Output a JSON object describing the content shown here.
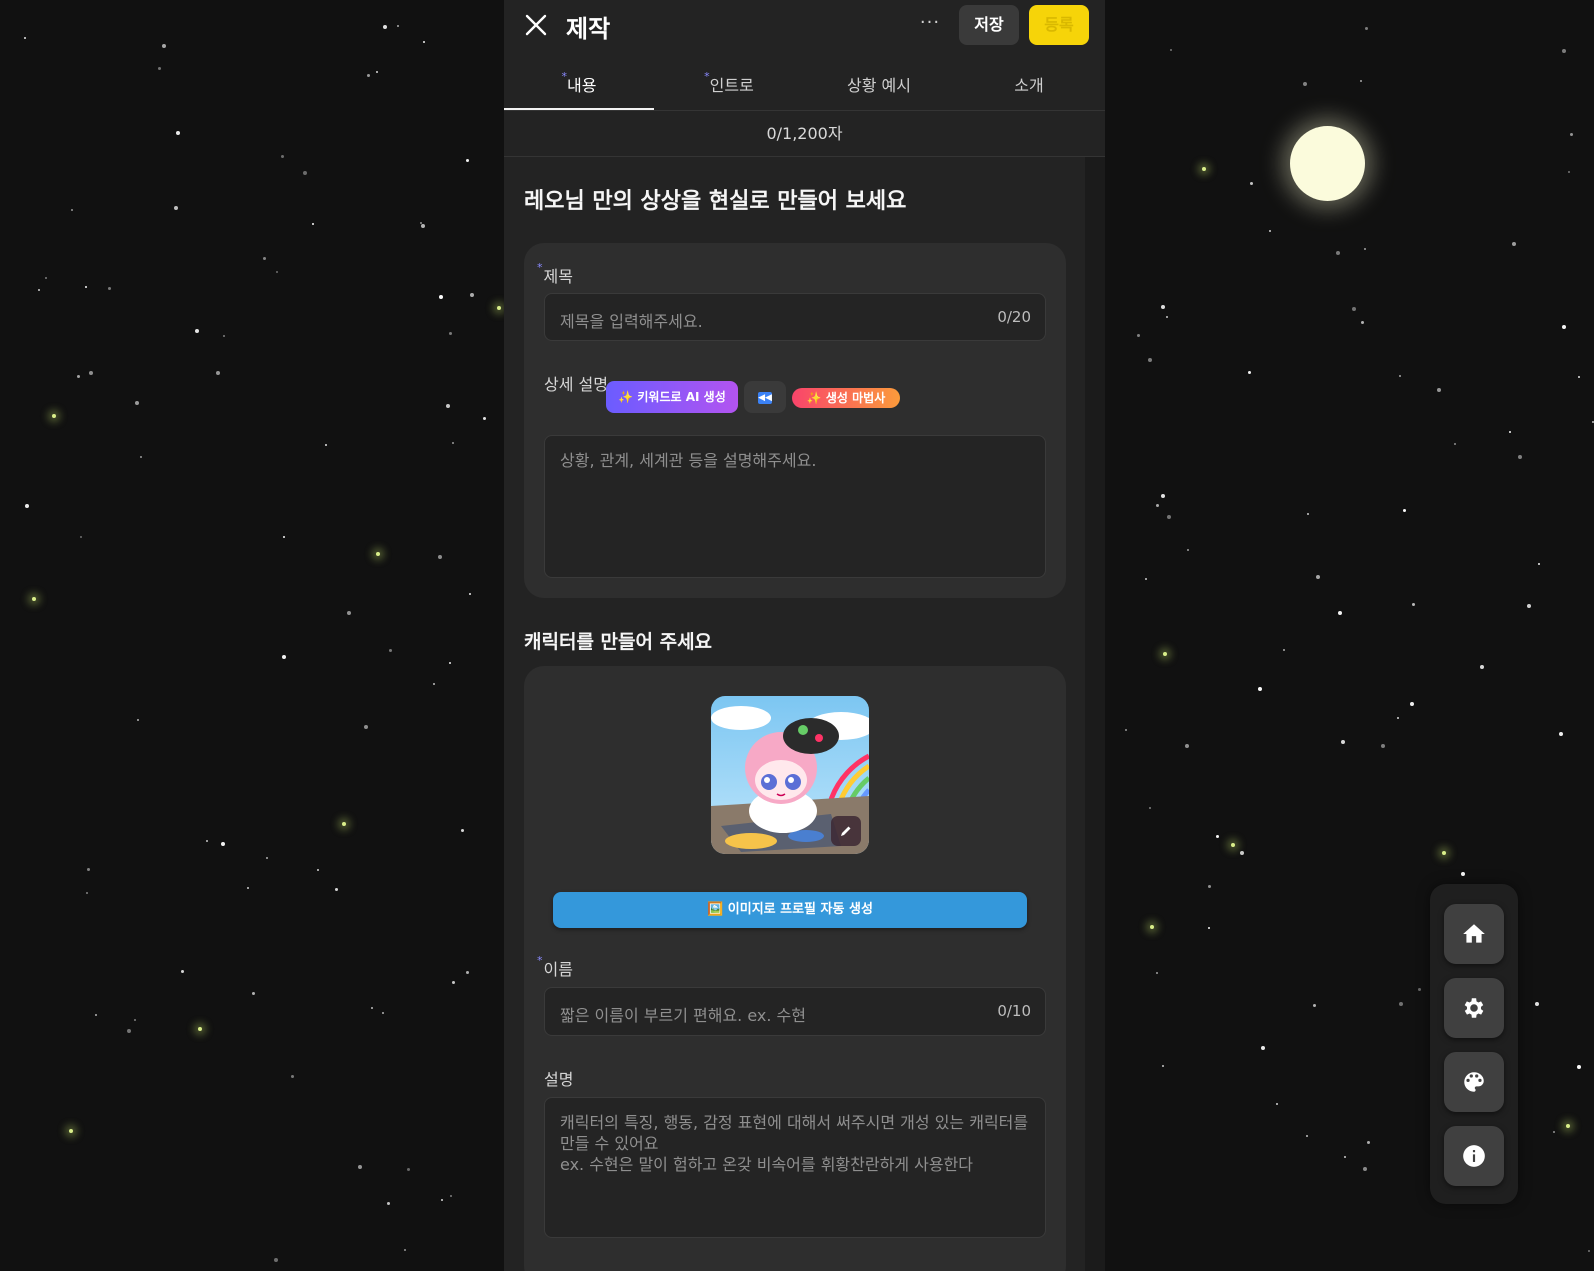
{
  "header": {
    "title": "제작",
    "more_label": "···",
    "save_label": "저장",
    "register_label": "등록"
  },
  "tabs": [
    {
      "label": "내용",
      "required": "*"
    },
    {
      "label": "인트로",
      "required": "*"
    },
    {
      "label": "상황 예시",
      "required": ""
    },
    {
      "label": "소개",
      "required": ""
    }
  ],
  "counter": "0/1,200자",
  "world": {
    "heading": "레오님 만의 상상을 현실로 만들어 보세요",
    "title_label": "제목",
    "title_required": "*",
    "title_placeholder": "제목을 입력해주세요.",
    "title_count": "0/20",
    "detail_label": "상세 설명",
    "ai_button_label": "✨ 키워드로 AI 생성",
    "wizard_button_label": "✨ 생성 마법사",
    "detail_placeholder": "상황, 관계, 세계관 등을 설명해주세요."
  },
  "character": {
    "heading": "캐릭터를 만들어 주세요",
    "autogen_label": "🖼️ 이미지로 프로필 자동 생성",
    "name_label": "이름",
    "name_required": "*",
    "name_placeholder": "짧은 이름이 부르기 편해요. ex. 수현",
    "name_count": "0/10",
    "desc_label": "설명",
    "desc_placeholder": "캐릭터의 특징, 행동, 감정 표현에 대해서 써주시면 개성 있는 캐릭터를 만들 수 있어요\nex. 수현은 말이 험하고 온갖 비속어를 휘황찬란하게 사용한다"
  },
  "dock": [
    "home-icon",
    "gear-icon",
    "palette-icon",
    "info-icon"
  ],
  "colors": {
    "background": "#111111",
    "panel": "#232323",
    "card": "#2e2e2e",
    "accent_yellow": "#f6d409",
    "accent_blue": "#3498db",
    "moon": "#fbfbdc"
  }
}
